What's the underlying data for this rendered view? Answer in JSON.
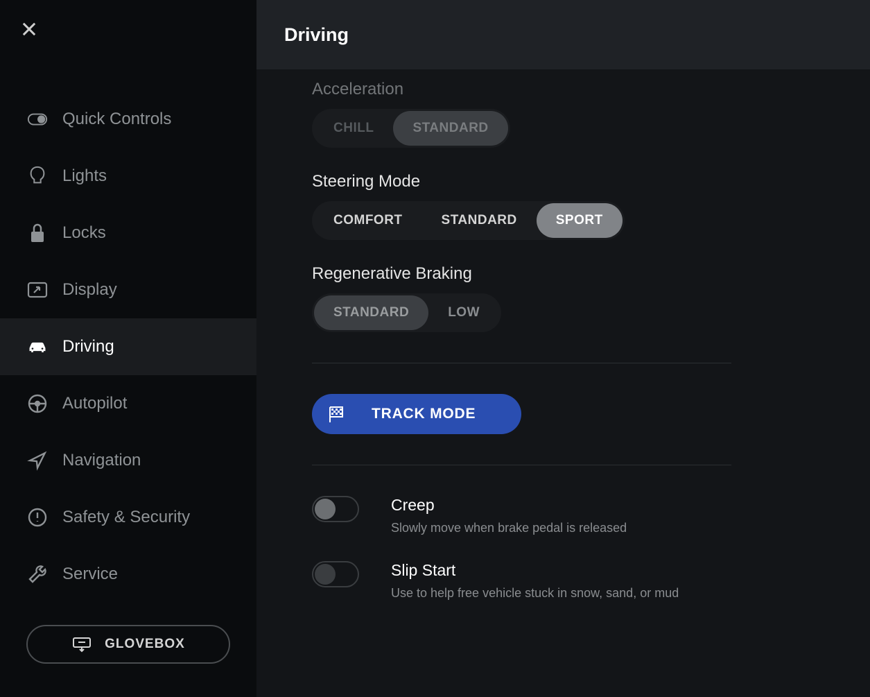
{
  "header": {
    "title": "Driving"
  },
  "sidebar": {
    "items": [
      {
        "label": "Quick Controls",
        "icon": "toggle-icon",
        "active": false
      },
      {
        "label": "Lights",
        "icon": "lightbulb-icon",
        "active": false
      },
      {
        "label": "Locks",
        "icon": "lock-icon",
        "active": false
      },
      {
        "label": "Display",
        "icon": "display-icon",
        "active": false
      },
      {
        "label": "Driving",
        "icon": "car-icon",
        "active": true
      },
      {
        "label": "Autopilot",
        "icon": "steering-wheel-icon",
        "active": false
      },
      {
        "label": "Navigation",
        "icon": "navigation-icon",
        "active": false
      },
      {
        "label": "Safety & Security",
        "icon": "alert-icon",
        "active": false
      },
      {
        "label": "Service",
        "icon": "wrench-icon",
        "active": false
      }
    ],
    "glovebox_label": "GLOVEBOX"
  },
  "settings": {
    "acceleration": {
      "label": "Acceleration",
      "options": [
        "CHILL",
        "STANDARD"
      ],
      "selected": "STANDARD"
    },
    "steering_mode": {
      "label": "Steering Mode",
      "options": [
        "COMFORT",
        "STANDARD",
        "SPORT"
      ],
      "selected": "SPORT"
    },
    "regen_braking": {
      "label": "Regenerative Braking",
      "options": [
        "STANDARD",
        "LOW"
      ],
      "selected": "STANDARD"
    },
    "track_mode_label": "TRACK MODE",
    "creep": {
      "label": "Creep",
      "desc": "Slowly move when brake pedal is released",
      "on": false
    },
    "slip_start": {
      "label": "Slip Start",
      "desc": "Use to help free vehicle stuck in snow, sand, or mud",
      "on": false
    }
  }
}
